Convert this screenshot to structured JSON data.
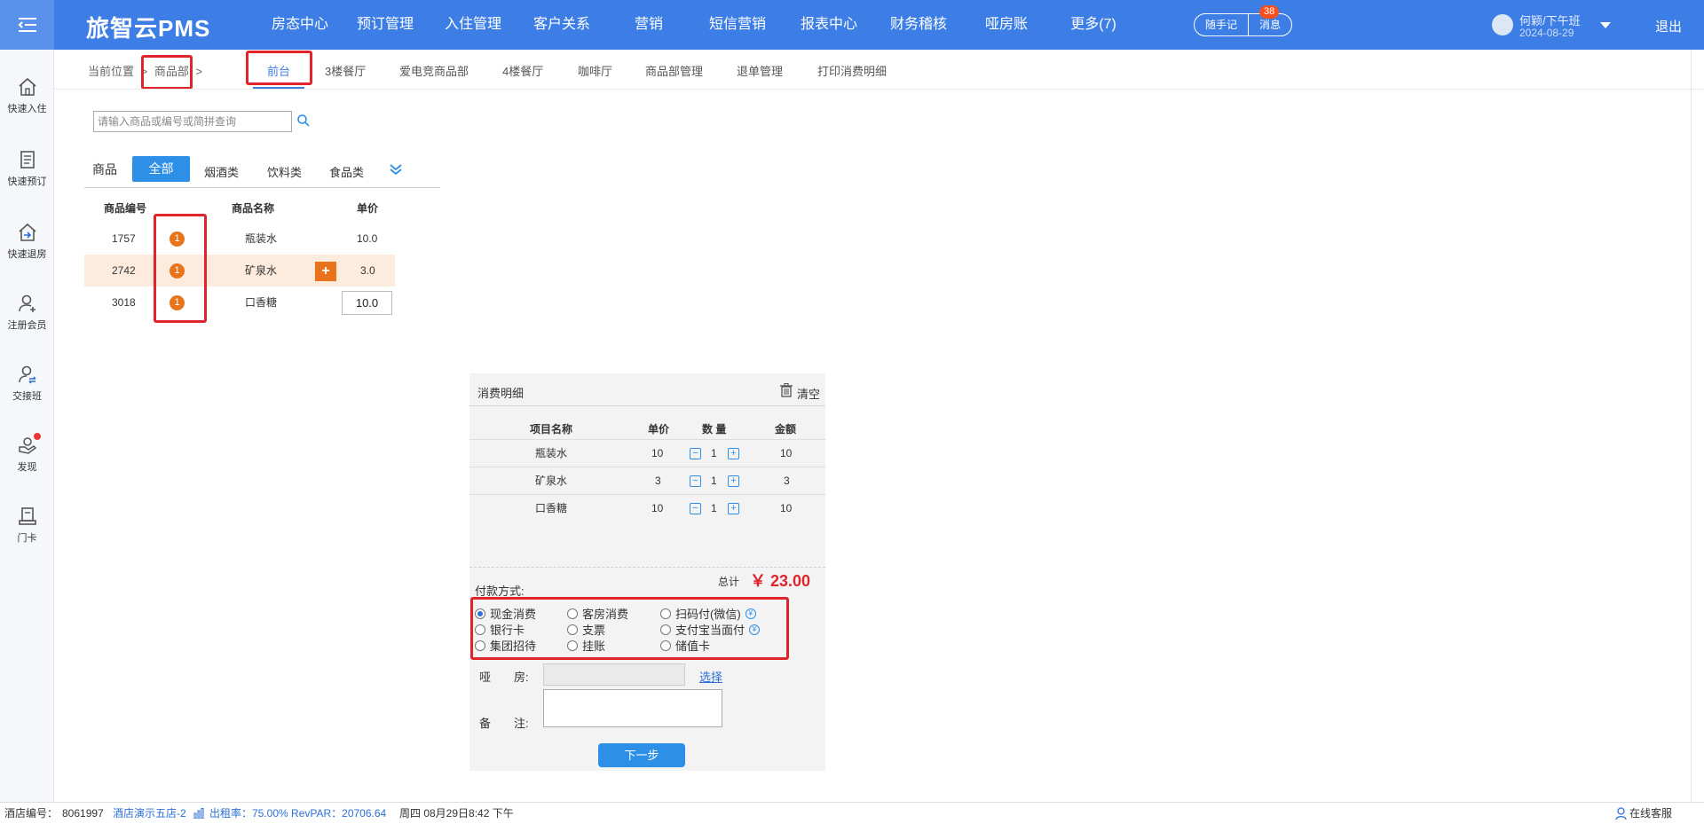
{
  "topbar": {
    "logo": "旅智云PMS",
    "nav": [
      "房态中心",
      "预订管理",
      "入住管理",
      "客户关系",
      "营销",
      "短信营销",
      "报表中心",
      "财务稽核",
      "哑房账",
      "更多(7)"
    ],
    "notes_label": "随手记",
    "messages_label": "消息",
    "messages_count": "38",
    "user_name": "何颖/下午班",
    "user_date": "2024-08-29",
    "logout": "退出"
  },
  "sidebar": [
    {
      "label": "快速入住",
      "icon": "home-icon"
    },
    {
      "label": "快速预订",
      "icon": "booking-icon"
    },
    {
      "label": "快速退房",
      "icon": "checkout-icon"
    },
    {
      "label": "注册会员",
      "icon": "add-member-icon"
    },
    {
      "label": "交接班",
      "icon": "shift-handover-icon"
    },
    {
      "label": "发现",
      "icon": "discover-icon"
    },
    {
      "label": "门卡",
      "icon": "door-card-icon"
    }
  ],
  "breadcrumb": {
    "prefix": "当前位置",
    "sep": ">",
    "current": "商品部",
    "trail": ">"
  },
  "tabs": [
    "前台",
    "3楼餐厅",
    "爱电竞商品部",
    "4楼餐厅",
    "咖啡厅",
    "商品部管理",
    "退单管理",
    "打印消费明细"
  ],
  "search": {
    "placeholder": "请输入商品或编号或简拼查询"
  },
  "categories": {
    "label": "商品",
    "items": [
      "全部",
      "烟酒类",
      "饮料类",
      "食品类"
    ]
  },
  "products": {
    "headers": {
      "code": "商品编号",
      "name": "商品名称",
      "price": "单价"
    },
    "rows": [
      {
        "code": "1757",
        "badge": "1",
        "name": "瓶装水",
        "price": "10.0"
      },
      {
        "code": "2742",
        "badge": "1",
        "name": "矿泉水",
        "price": "3.0",
        "add": "+"
      },
      {
        "code": "3018",
        "badge": "1",
        "name": "口香糖",
        "price": "10.0"
      }
    ]
  },
  "consumption": {
    "title": "消费明细",
    "clear": "清空",
    "headers": {
      "item": "项目名称",
      "price": "单价",
      "qty": "数 量",
      "amount": "金额"
    },
    "rows": [
      {
        "item": "瓶装水",
        "price": "10",
        "qty": "1",
        "amount": "10"
      },
      {
        "item": "矿泉水",
        "price": "3",
        "qty": "1",
        "amount": "3"
      },
      {
        "item": "口香糖",
        "price": "10",
        "qty": "1",
        "amount": "10"
      }
    ],
    "minus": "−",
    "plus": "+",
    "total_label": "总计",
    "total_value": "￥ 23.00",
    "pay_label": "付款方式:",
    "pay_methods": [
      "现金消费",
      "客房消费",
      "扫码付(微信)",
      "银行卡",
      "支票",
      "支付宝当面付",
      "集团招待",
      "挂账",
      "储值卡"
    ],
    "pay_selected": "现金消费",
    "yen": "¥",
    "room_label_1": "哑",
    "room_label_2": "房:",
    "select_link": "选择",
    "note_label_1": "备",
    "note_label_2": "注:",
    "next": "下一步"
  },
  "statusbar": {
    "hotel_no_label": "酒店编号：",
    "hotel_no": "8061997",
    "hotel_name": "酒店演示五店-2",
    "occupancy": "出租率：75.00% RevPAR：20706.64",
    "datetime": "周四 08月29日8:42 下午",
    "service": "在线客服"
  },
  "colors": {
    "primary": "#3d7ee6",
    "accent_orange": "#e8731a",
    "highlight": "#e0242c"
  }
}
